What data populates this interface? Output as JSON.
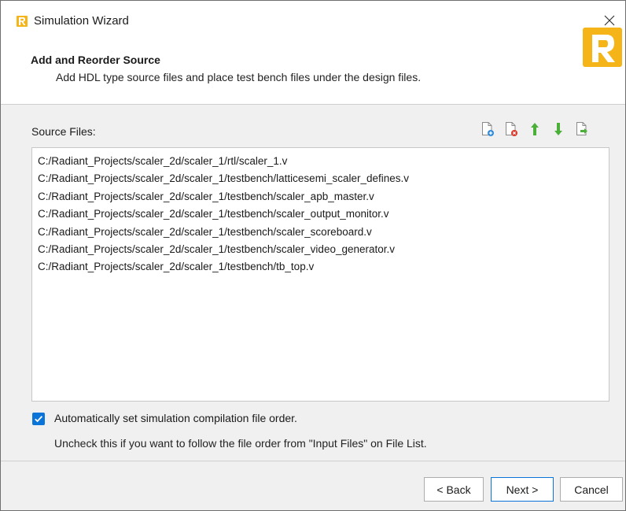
{
  "window": {
    "title": "Simulation Wizard"
  },
  "header": {
    "title": "Add and Reorder Source",
    "description": "Add HDL type source files and place test bench files under the design files."
  },
  "source_files": {
    "label": "Source Files:",
    "toolbar_icons": [
      "add-file-icon",
      "remove-file-icon",
      "move-up-icon",
      "move-down-icon",
      "export-file-icon"
    ],
    "files": [
      "C:/Radiant_Projects/scaler_2d/scaler_1/rtl/scaler_1.v",
      "C:/Radiant_Projects/scaler_2d/scaler_1/testbench/latticesemi_scaler_defines.v",
      "C:/Radiant_Projects/scaler_2d/scaler_1/testbench/scaler_apb_master.v",
      "C:/Radiant_Projects/scaler_2d/scaler_1/testbench/scaler_output_monitor.v",
      "C:/Radiant_Projects/scaler_2d/scaler_1/testbench/scaler_scoreboard.v",
      "C:/Radiant_Projects/scaler_2d/scaler_1/testbench/scaler_video_generator.v",
      "C:/Radiant_Projects/scaler_2d/scaler_1/testbench/tb_top.v"
    ]
  },
  "options": {
    "auto_order_label": "Automatically set simulation compilation file order.",
    "auto_order_checked": true,
    "hint": "Uncheck this if you want to follow the file order from \"Input Files\" on File List."
  },
  "buttons": {
    "back": "< Back",
    "next": "Next >",
    "cancel": "Cancel"
  },
  "colors": {
    "accent": "#0a74d8",
    "brand": "#f5b417",
    "move_arrows": "#4caf3a"
  }
}
